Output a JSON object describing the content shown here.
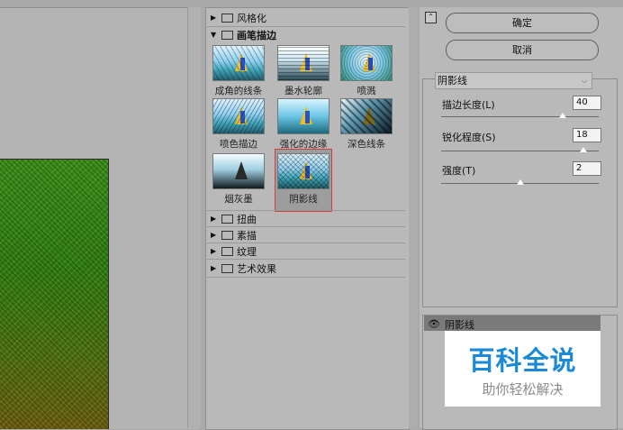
{
  "categories_top": [
    {
      "label": "风格化",
      "arrow": "▶",
      "expanded": false
    },
    {
      "label": "画笔描边",
      "arrow": "▼",
      "expanded": true
    }
  ],
  "brush_filters": [
    {
      "label": "成角的线条"
    },
    {
      "label": "墨水轮廓"
    },
    {
      "label": "喷溅"
    },
    {
      "label": "喷色描边"
    },
    {
      "label": "强化的边缘"
    },
    {
      "label": "深色线条"
    },
    {
      "label": "烟灰墨"
    },
    {
      "label": "阴影线",
      "selected": true
    }
  ],
  "categories_bottom": [
    {
      "label": "扭曲",
      "arrow": "▶"
    },
    {
      "label": "素描",
      "arrow": "▶"
    },
    {
      "label": "纹理",
      "arrow": "▶"
    },
    {
      "label": "艺术效果",
      "arrow": "▶"
    }
  ],
  "buttons": {
    "ok": "确定",
    "cancel": "取消",
    "collapse_glyph": "⌃"
  },
  "selected_filter": "阴影线",
  "params": [
    {
      "label": "描边长度(L)",
      "value": "40",
      "slider": 0.77
    },
    {
      "label": "锐化程度(S)",
      "value": "18",
      "slider": 0.9
    },
    {
      "label": "强度(T)",
      "value": "2",
      "slider": 0.5
    }
  ],
  "layer": {
    "name": "阴影线"
  },
  "watermark": {
    "title": "百科全说",
    "subtitle": "助你轻松解决"
  },
  "colors": {
    "selection_outline": "#d63c3c",
    "watermark_title": "#1a8ad8"
  }
}
